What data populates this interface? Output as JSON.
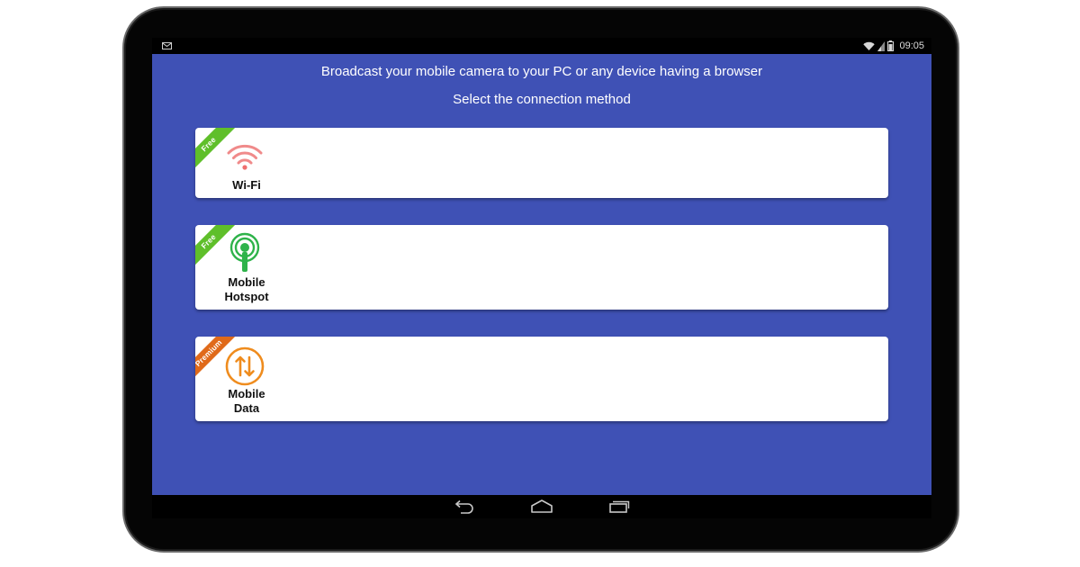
{
  "status_bar": {
    "time": "09:05",
    "icons": [
      "mail-icon",
      "wifi-icon",
      "signal-icon",
      "battery-icon"
    ]
  },
  "app": {
    "headline": "Broadcast your mobile camera to your PC or any device having a browser",
    "subheadline": "Select the connection method",
    "background_color": "#3f51b5"
  },
  "options": [
    {
      "badge": "Free",
      "badge_color": "#5fbf2a",
      "icon": "wifi-icon",
      "icon_color": "#f08080",
      "label_line1": "Wi-Fi",
      "label_line2": ""
    },
    {
      "badge": "Free",
      "badge_color": "#5fbf2a",
      "icon": "hotspot-icon",
      "icon_color": "#2eb34a",
      "label_line1": "Mobile",
      "label_line2": "Hotspot"
    },
    {
      "badge": "Premium",
      "badge_color": "#e06a1a",
      "icon": "mobile-data-icon",
      "icon_color": "#ef8c1e",
      "label_line1": "Mobile",
      "label_line2": "Data"
    }
  ],
  "navigation": {
    "icons": [
      "back-icon",
      "home-icon",
      "recent-apps-icon"
    ]
  }
}
